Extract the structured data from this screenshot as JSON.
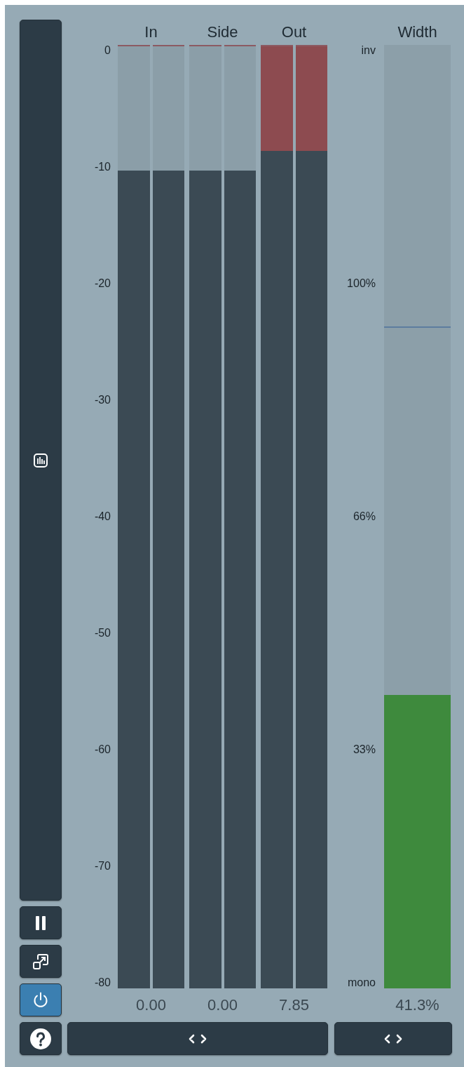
{
  "side_buttons": [
    {
      "kind": "meters"
    },
    {
      "kind": "pause"
    },
    {
      "kind": "resize"
    },
    {
      "kind": "power",
      "on": true
    },
    {
      "kind": "help"
    }
  ],
  "level_meters": {
    "scale": [
      "0",
      "-10",
      "-20",
      "-30",
      "-40",
      "-50",
      "-60",
      "-70",
      "-80"
    ],
    "groups": [
      {
        "label": "In",
        "readout": "0.00",
        "channels": [
          {
            "level": 0.868,
            "clipping": false
          },
          {
            "level": 0.868,
            "clipping": false
          }
        ]
      },
      {
        "label": "Side",
        "readout": "0.00",
        "channels": [
          {
            "level": 0.868,
            "clipping": false
          },
          {
            "level": 0.868,
            "clipping": false
          }
        ]
      },
      {
        "label": "Out",
        "readout": "7.85",
        "channels": [
          {
            "level": 0.889,
            "clipping": true
          },
          {
            "level": 0.889,
            "clipping": true
          }
        ]
      }
    ]
  },
  "width_meter": {
    "label": "Width",
    "scale": [
      "inv",
      "100%",
      "66%",
      "33%",
      "mono"
    ],
    "level": 0.311,
    "peak_marker": {
      "level": 0.7
    },
    "readout": "41.3%"
  },
  "bottom_buttons": [
    {
      "kind": "chevrons"
    },
    {
      "kind": "chevrons"
    }
  ]
}
